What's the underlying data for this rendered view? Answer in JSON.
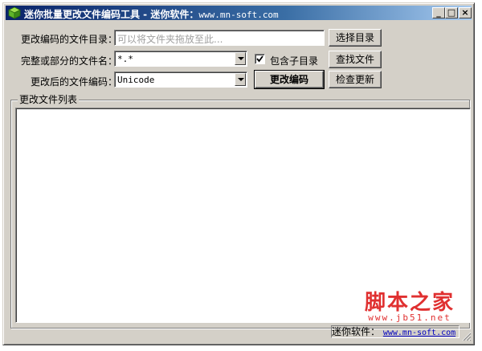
{
  "window": {
    "title": "迷你批量更改文件编码工具 - 迷你软件：",
    "title_url": "www.mn-soft.com",
    "controls": {
      "minimize": "_",
      "maximize": "□",
      "close": "×"
    }
  },
  "form": {
    "dir_label": "更改编码的文件目录：",
    "dir_placeholder": "可以将文件夹拖放至此...",
    "filename_label": "完整或部分的文件名：",
    "filename_value": "*.*",
    "encoding_label": "更改后的文件编码：",
    "encoding_value": "Unicode",
    "include_subdirs_label": "包含子目录",
    "include_subdirs_checked": true
  },
  "buttons": {
    "select_dir": "选择目录",
    "find_files": "查找文件",
    "change_encoding": "更改编码",
    "check_update": "检查更新"
  },
  "list": {
    "title": "更改文件列表"
  },
  "status": {
    "label": "迷你软件：",
    "link": "www.mn-soft.com"
  },
  "watermark": {
    "main": "脚本之家",
    "sub": "www.jb51.net"
  },
  "icons": {
    "app": "cube-icon",
    "check": "check-icon",
    "dropdown": "chevron-down-icon",
    "grip": "resize-grip-icon"
  }
}
